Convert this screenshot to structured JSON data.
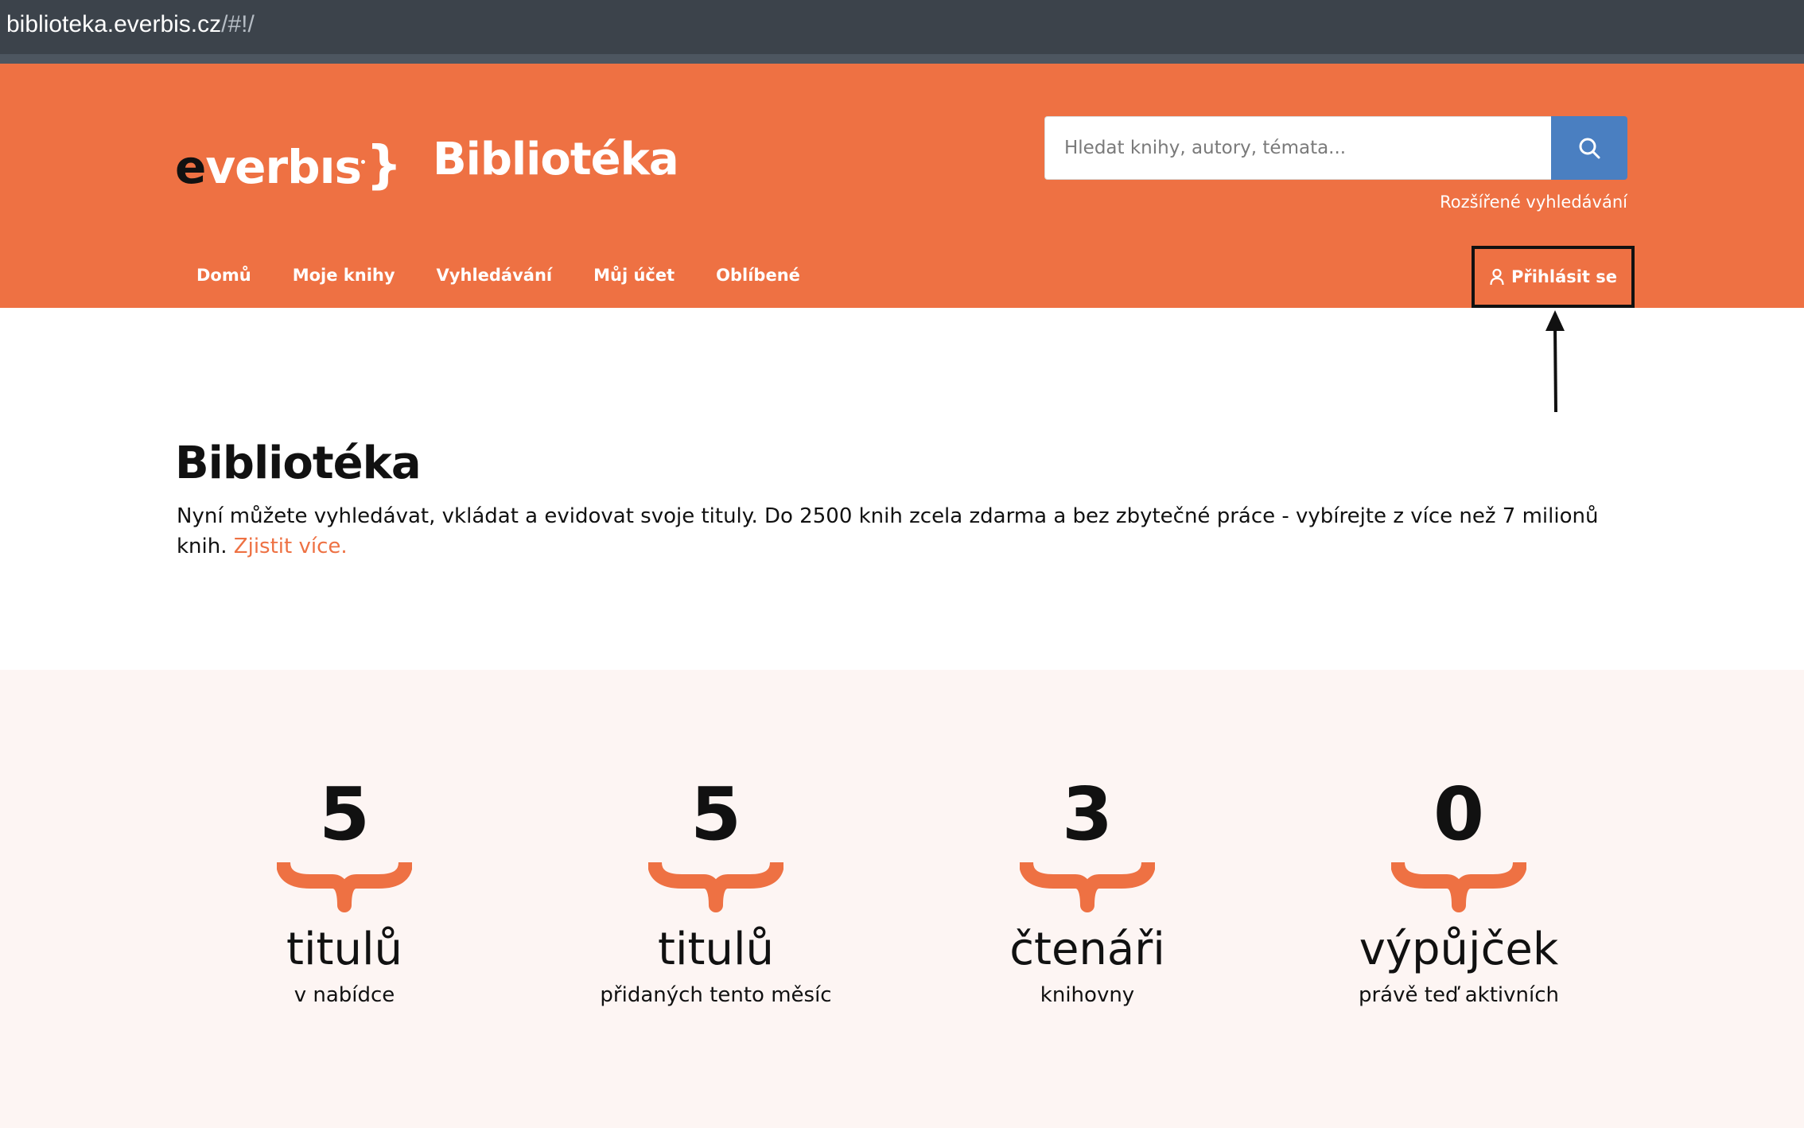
{
  "browser": {
    "url_host": "biblioteka.everbis.cz",
    "url_path": "/#!/"
  },
  "header": {
    "logo_first_letter": "e",
    "logo_rest": "verbıs",
    "logo_brace": "}",
    "site_title": "Bibliotéka",
    "search_placeholder": "Hledat knihy, autory, témata...",
    "advanced_search": "Rozšířené vyhledávání",
    "nav": [
      {
        "label": "Domů"
      },
      {
        "label": "Moje knihy"
      },
      {
        "label": "Vyhledávání"
      },
      {
        "label": "Můj účet"
      },
      {
        "label": "Oblíbené"
      }
    ],
    "login_label": "Přihlásit se"
  },
  "intro": {
    "title": "Bibliotéka",
    "text": "Nyní můžete vyhledávat, vkládat a evidovat svoje tituly. Do 2500 knih zcela zdarma a bez zbytečné práce - vybírejte z více než 7 milionů knih.",
    "more_link": "Zjistit více."
  },
  "stats": [
    {
      "value": "5",
      "unit": "titulů",
      "desc": "v nabídce"
    },
    {
      "value": "5",
      "unit": "titulů",
      "desc": "přidaných tento měsíc"
    },
    {
      "value": "3",
      "unit": "čtenáři",
      "desc": "knihovny"
    },
    {
      "value": "0",
      "unit": "výpůjček",
      "desc": "právě teď aktivních"
    }
  ],
  "colors": {
    "brand_orange": "#ee7143",
    "search_button": "#4a7fc1",
    "stats_background": "#fdf5f3"
  }
}
